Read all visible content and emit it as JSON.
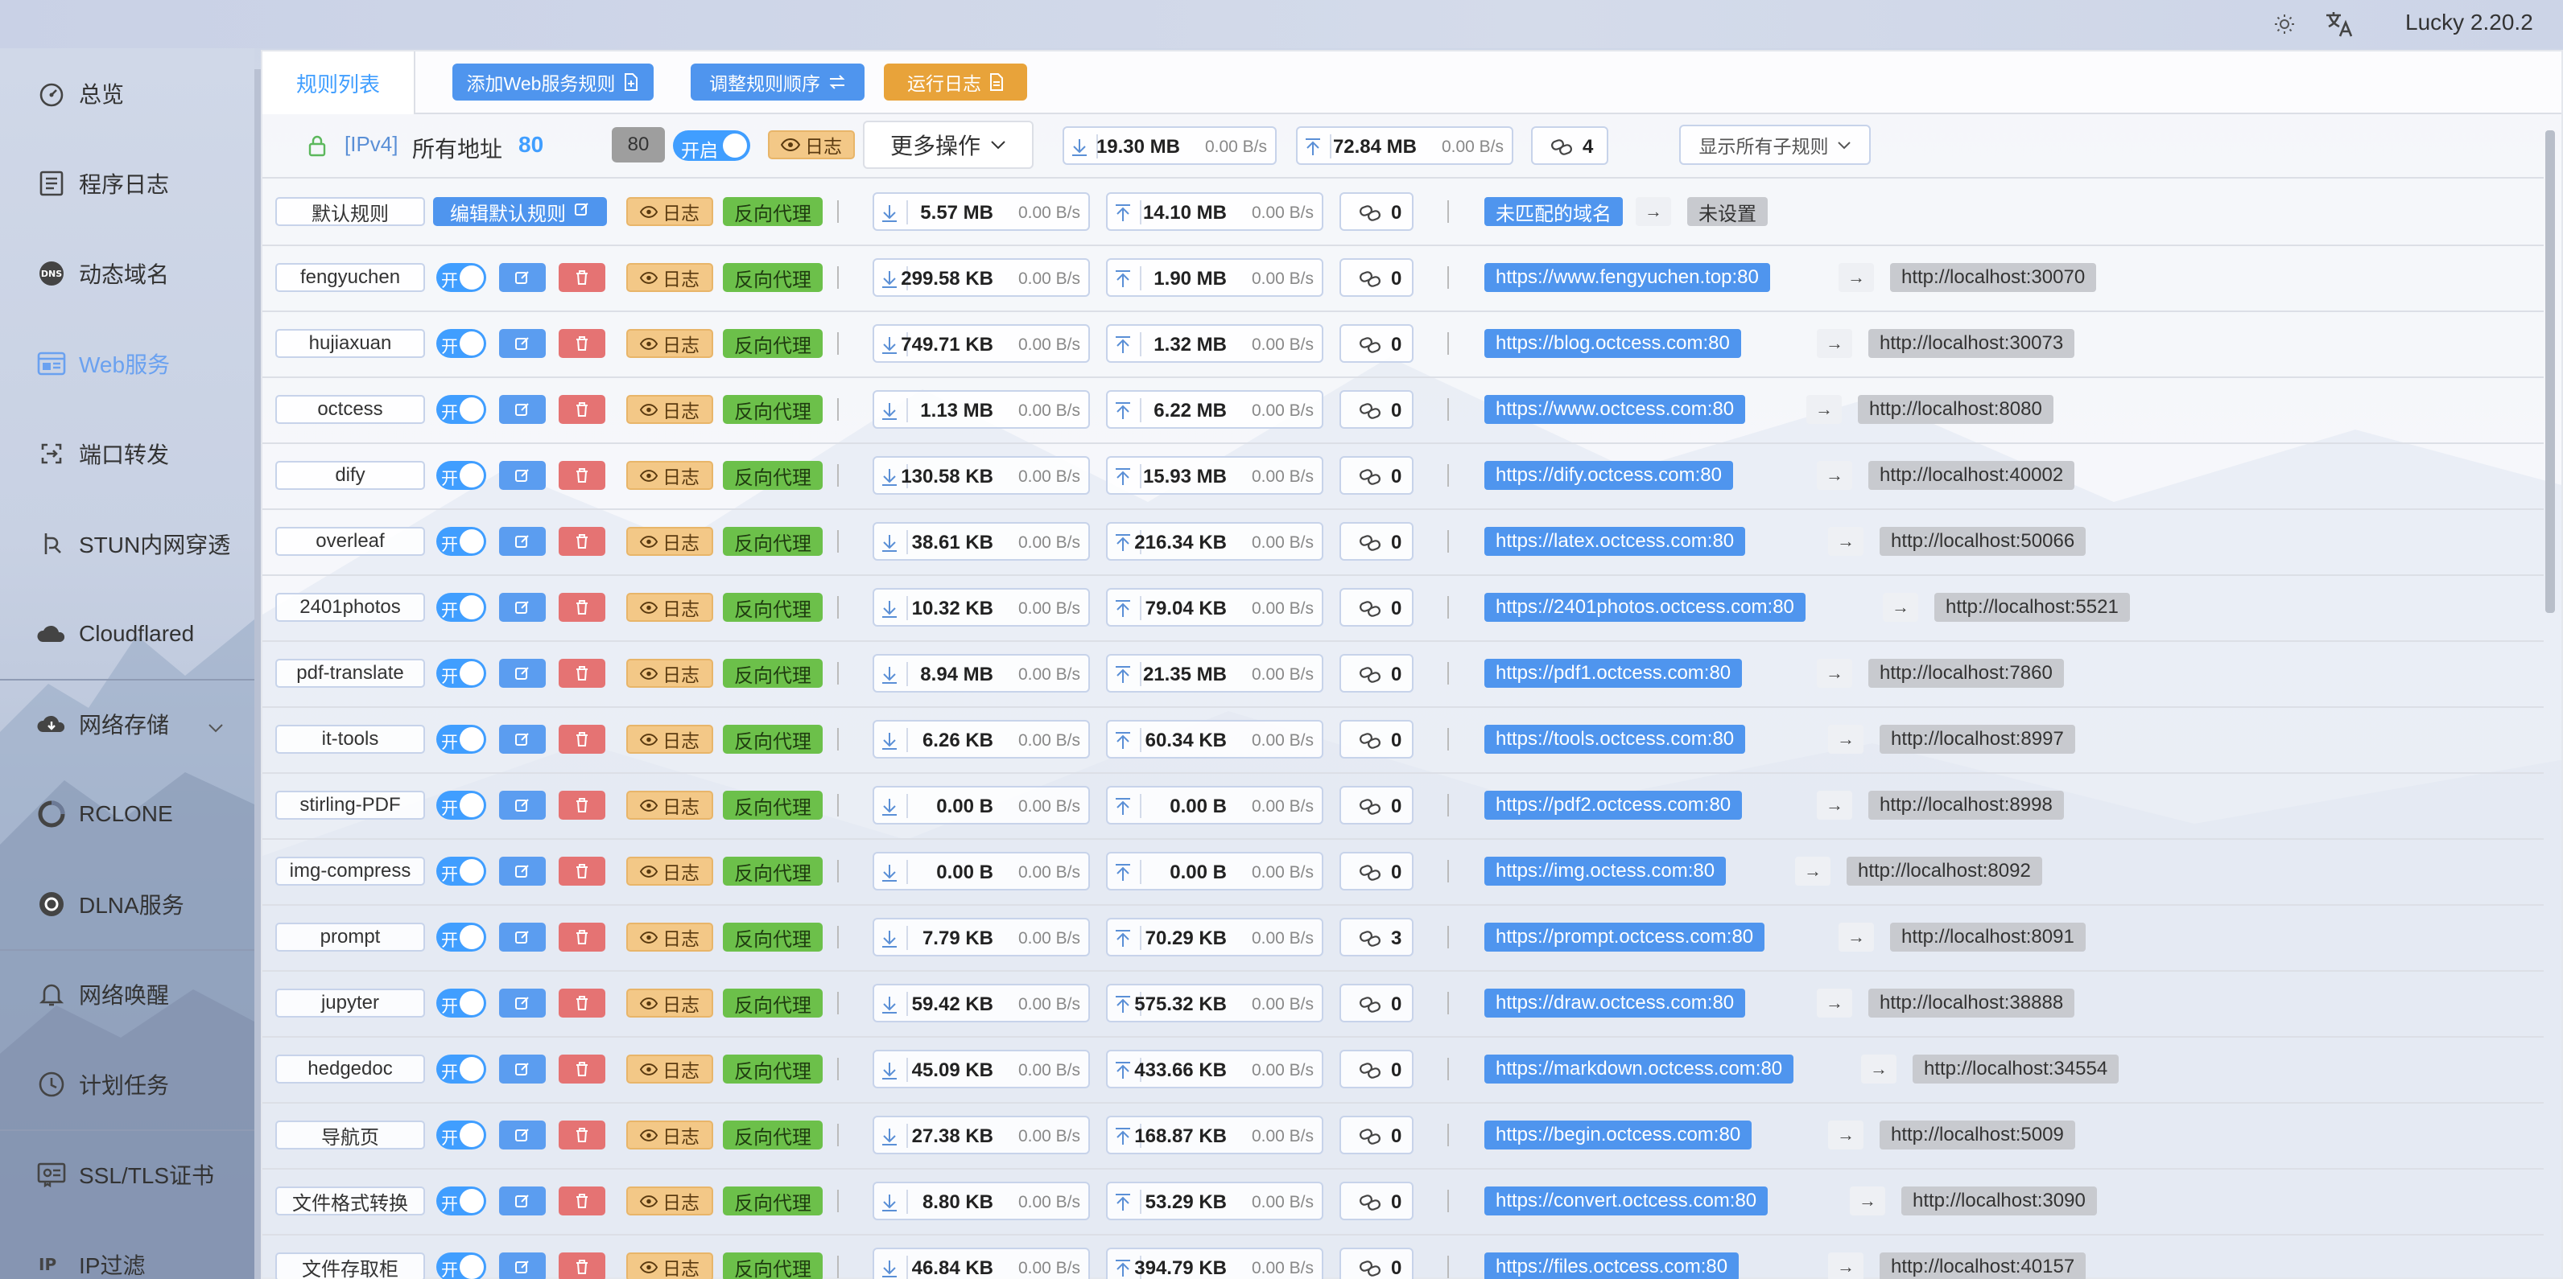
{
  "app": {
    "version": "Lucky 2.20.2",
    "theme_icon": "sun-icon",
    "lang_icon": "translate-icon"
  },
  "sidebar": {
    "items": [
      {
        "label": "总览",
        "icon": "dashboard-icon"
      },
      {
        "label": "程序日志",
        "icon": "log-icon"
      },
      {
        "label": "动态域名",
        "icon": "ddns-icon"
      },
      {
        "label": "Web服务",
        "icon": "web-icon",
        "active": true
      },
      {
        "label": "端口转发",
        "icon": "port-forward-icon"
      },
      {
        "label": "STUN内网穿透",
        "icon": "stun-icon"
      },
      {
        "label": "Cloudflared",
        "icon": "cloud-icon"
      },
      {
        "label": "网络存储",
        "icon": "cloud-storage-icon"
      },
      {
        "label": "RCLONE",
        "icon": "rclone-icon"
      },
      {
        "label": "DLNA服务",
        "icon": "dlna-icon"
      },
      {
        "label": "网络唤醒",
        "icon": "bell-icon"
      },
      {
        "label": "计划任务",
        "icon": "clock-icon"
      },
      {
        "label": "SSL/TLS证书",
        "icon": "certificate-icon"
      },
      {
        "label": "IP过滤",
        "icon": "ip-filter-icon"
      }
    ]
  },
  "tabs": {
    "active": "规则列表",
    "add_rule": "添加Web服务规则",
    "reorder": "调整规则顺序",
    "run_log": "运行日志"
  },
  "summary": {
    "ip_version": "[IPv4]",
    "address": "所有地址",
    "port": "80",
    "port_badge": "80",
    "switch_label": "开启",
    "log_label": "日志",
    "more_ops": "更多操作",
    "download": {
      "size": "19.30 MB",
      "speed": "0.00 B/s"
    },
    "upload": {
      "size": "72.84 MB",
      "speed": "0.00 B/s"
    },
    "connections": "4",
    "show_sub": "显示所有子规则"
  },
  "default_rule": {
    "name": "默认规则",
    "edit": "编辑默认规则",
    "log_label": "日志",
    "type": "反向代理",
    "download": {
      "size": "5.57 MB",
      "speed": "0.00 B/s"
    },
    "upload": {
      "size": "14.10 MB",
      "speed": "0.00 B/s"
    },
    "connections": "0",
    "domain": "未匹配的域名",
    "arrow": "→",
    "target": "未设置"
  },
  "rules": [
    {
      "name": "fengyuchen",
      "switch": "开",
      "log": "日志",
      "type": "反向代理",
      "down": "299.58 KB",
      "down_speed": "0.00 B/s",
      "up": "1.90 MB",
      "up_speed": "0.00 B/s",
      "conn": "0",
      "domain": "https://www.fengyuchen.top:80",
      "arrow": "→",
      "target": "http://localhost:30070"
    },
    {
      "name": "hujiaxuan",
      "switch": "开",
      "log": "日志",
      "type": "反向代理",
      "down": "749.71 KB",
      "down_speed": "0.00 B/s",
      "up": "1.32 MB",
      "up_speed": "0.00 B/s",
      "conn": "0",
      "domain": "https://blog.octcess.com:80",
      "arrow": "→",
      "target": "http://localhost:30073"
    },
    {
      "name": "octcess",
      "switch": "开",
      "log": "日志",
      "type": "反向代理",
      "down": "1.13 MB",
      "down_speed": "0.00 B/s",
      "up": "6.22 MB",
      "up_speed": "0.00 B/s",
      "conn": "0",
      "domain": "https://www.octcess.com:80",
      "arrow": "→",
      "target": "http://localhost:8080"
    },
    {
      "name": "dify",
      "switch": "开",
      "log": "日志",
      "type": "反向代理",
      "down": "130.58 KB",
      "down_speed": "0.00 B/s",
      "up": "15.93 MB",
      "up_speed": "0.00 B/s",
      "conn": "0",
      "domain": "https://dify.octcess.com:80",
      "arrow": "→",
      "target": "http://localhost:40002"
    },
    {
      "name": "overleaf",
      "switch": "开",
      "log": "日志",
      "type": "反向代理",
      "down": "38.61 KB",
      "down_speed": "0.00 B/s",
      "up": "216.34 KB",
      "up_speed": "0.00 B/s",
      "conn": "0",
      "domain": "https://latex.octcess.com:80",
      "arrow": "→",
      "target": "http://localhost:50066"
    },
    {
      "name": "2401photos",
      "switch": "开",
      "log": "日志",
      "type": "反向代理",
      "down": "10.32 KB",
      "down_speed": "0.00 B/s",
      "up": "79.04 KB",
      "up_speed": "0.00 B/s",
      "conn": "0",
      "domain": "https://2401photos.octcess.com:80",
      "arrow": "→",
      "target": "http://localhost:5521"
    },
    {
      "name": "pdf-translate",
      "switch": "开",
      "log": "日志",
      "type": "反向代理",
      "down": "8.94 MB",
      "down_speed": "0.00 B/s",
      "up": "21.35 MB",
      "up_speed": "0.00 B/s",
      "conn": "0",
      "domain": "https://pdf1.octcess.com:80",
      "arrow": "→",
      "target": "http://localhost:7860"
    },
    {
      "name": "it-tools",
      "switch": "开",
      "log": "日志",
      "type": "反向代理",
      "down": "6.26 KB",
      "down_speed": "0.00 B/s",
      "up": "60.34 KB",
      "up_speed": "0.00 B/s",
      "conn": "0",
      "domain": "https://tools.octcess.com:80",
      "arrow": "→",
      "target": "http://localhost:8997"
    },
    {
      "name": "stirling-PDF",
      "switch": "开",
      "log": "日志",
      "type": "反向代理",
      "down": "0.00 B",
      "down_speed": "0.00 B/s",
      "up": "0.00 B",
      "up_speed": "0.00 B/s",
      "conn": "0",
      "domain": "https://pdf2.octcess.com:80",
      "arrow": "→",
      "target": "http://localhost:8998"
    },
    {
      "name": "img-compress",
      "switch": "开",
      "log": "日志",
      "type": "反向代理",
      "down": "0.00 B",
      "down_speed": "0.00 B/s",
      "up": "0.00 B",
      "up_speed": "0.00 B/s",
      "conn": "0",
      "domain": "https://img.octess.com:80",
      "arrow": "→",
      "target": "http://localhost:8092"
    },
    {
      "name": "prompt",
      "switch": "开",
      "log": "日志",
      "type": "反向代理",
      "down": "7.79 KB",
      "down_speed": "0.00 B/s",
      "up": "70.29 KB",
      "up_speed": "0.00 B/s",
      "conn": "3",
      "domain": "https://prompt.octcess.com:80",
      "arrow": "→",
      "target": "http://localhost:8091"
    },
    {
      "name": "jupyter",
      "switch": "开",
      "log": "日志",
      "type": "反向代理",
      "down": "59.42 KB",
      "down_speed": "0.00 B/s",
      "up": "575.32 KB",
      "up_speed": "0.00 B/s",
      "conn": "0",
      "domain": "https://draw.octcess.com:80",
      "arrow": "→",
      "target": "http://localhost:38888"
    },
    {
      "name": "hedgedoc",
      "switch": "开",
      "log": "日志",
      "type": "反向代理",
      "down": "45.09 KB",
      "down_speed": "0.00 B/s",
      "up": "433.66 KB",
      "up_speed": "0.00 B/s",
      "conn": "0",
      "domain": "https://markdown.octcess.com:80",
      "arrow": "→",
      "target": "http://localhost:34554"
    },
    {
      "name": "导航页",
      "switch": "开",
      "log": "日志",
      "type": "反向代理",
      "down": "27.38 KB",
      "down_speed": "0.00 B/s",
      "up": "168.87 KB",
      "up_speed": "0.00 B/s",
      "conn": "0",
      "domain": "https://begin.octcess.com:80",
      "arrow": "→",
      "target": "http://localhost:5009"
    },
    {
      "name": "文件格式转换",
      "switch": "开",
      "log": "日志",
      "type": "反向代理",
      "down": "8.80 KB",
      "down_speed": "0.00 B/s",
      "up": "53.29 KB",
      "up_speed": "0.00 B/s",
      "conn": "0",
      "domain": "https://convert.octcess.com:80",
      "arrow": "→",
      "target": "http://localhost:3090"
    },
    {
      "name": "文件存取柜",
      "switch": "开",
      "log": "日志",
      "type": "反向代理",
      "down": "46.84 KB",
      "down_speed": "0.00 B/s",
      "up": "394.79 KB",
      "up_speed": "0.00 B/s",
      "conn": "0",
      "domain": "https://files.octcess.com:80",
      "arrow": "→",
      "target": "http://localhost:40157"
    }
  ],
  "colors": {
    "primary": "#409eff",
    "danger": "#e57373",
    "warning": "#f3c887",
    "success": "#6cc04a",
    "domain": "#4f95ee",
    "target": "#c8cacf"
  }
}
